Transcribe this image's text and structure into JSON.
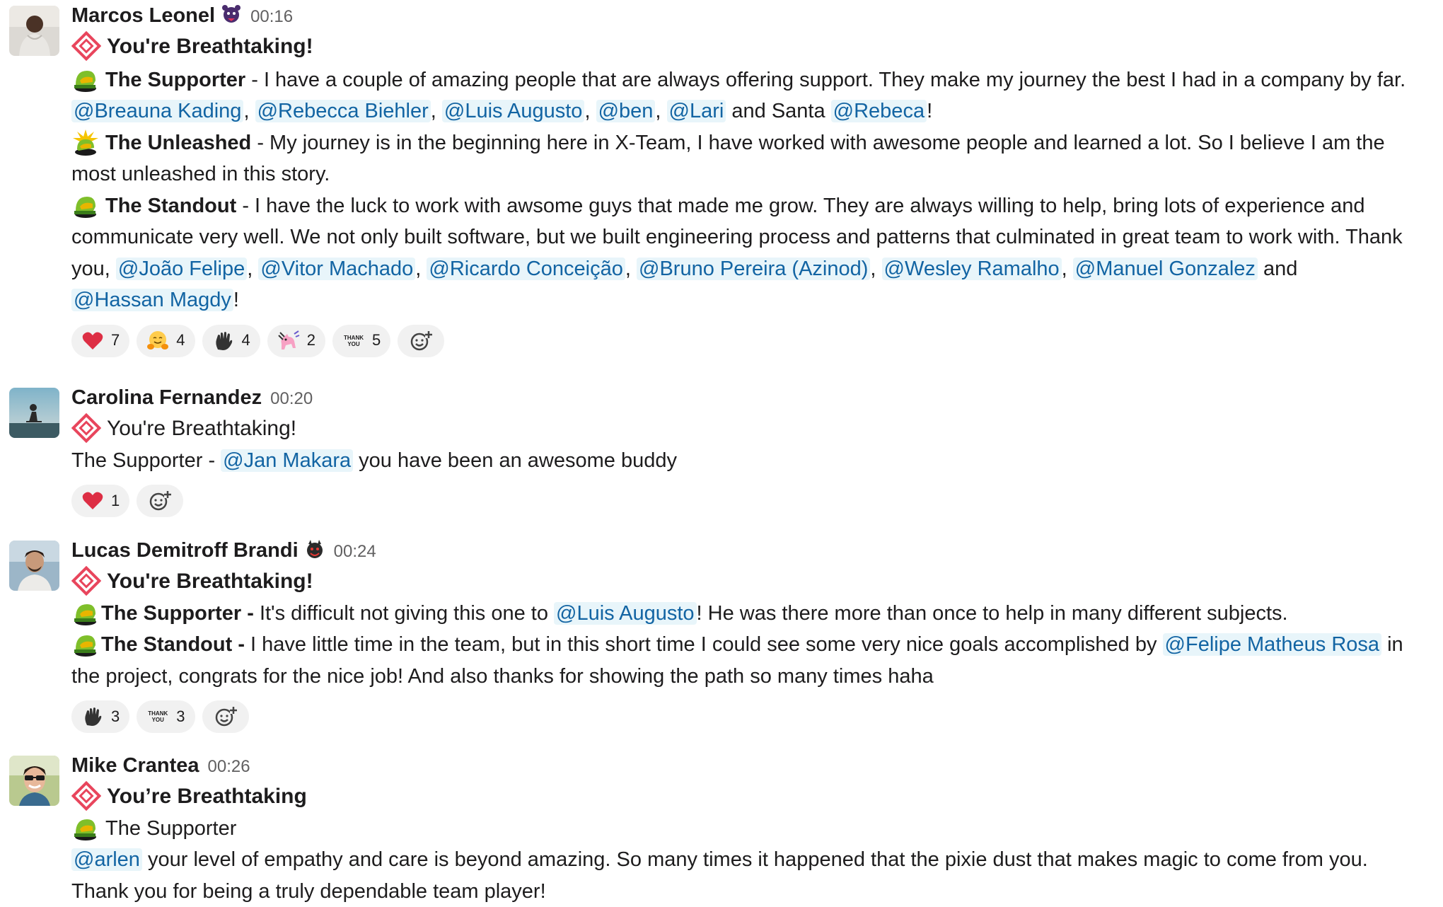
{
  "messages": [
    {
      "author": "Marcos Leonel",
      "time": "00:16",
      "title": "You're Breathtaking!",
      "supporter_label": "The Supporter",
      "supporter_text": " - I have a couple of amazing people that are always offering support. They make my journey the best I had in a company by far.",
      "supporter_mentions": [
        "@Breauna Kading",
        "@Rebecca Biehler",
        "@Luis Augusto",
        "@ben",
        "@Lari"
      ],
      "and_santa": "and Santa",
      "santa_mention": "@Rebeca",
      "unleashed_label": "The Unleashed",
      "unleashed_text": " - My journey is in the beginning here in X-Team, I have worked with awesome people and learned a lot. So I believe I am the most unleashed in this story.",
      "standout_label": "The Standout",
      "standout_text": " - I have the luck to work with awsome guys that made me grow. They are always willing to help, bring lots of experience and communicate very well. We not only built software, but we built engineering process and patterns that culminated in great team to work with.",
      "thank_you": "Thank you,",
      "standout_mentions": [
        "@João Felipe",
        "@Vitor Machado",
        "@Ricardo Conceição",
        "@Bruno Pereira (Azinod)",
        "@Wesley Ramalho",
        "@Manuel Gonzalez"
      ],
      "and_word": "and",
      "final_mention": "@Hassan Magdy",
      "reactions": [
        {
          "emoji": "heart-icon",
          "count": "7"
        },
        {
          "emoji": "hugging-face-icon",
          "count": "4"
        },
        {
          "emoji": "wave-hand-icon",
          "count": "4"
        },
        {
          "emoji": "party-pony-icon",
          "count": "2"
        },
        {
          "emoji": "thank-you-icon",
          "count": "5"
        }
      ]
    },
    {
      "author": "Carolina Fernandez",
      "time": "00:20",
      "title": "You're Breathtaking!",
      "supporter_label": "The Supporter - ",
      "mention": "@Jan Makara",
      "text": " you have been an awesome buddy",
      "reactions": [
        {
          "emoji": "heart-icon",
          "count": "1"
        }
      ]
    },
    {
      "author": "Lucas Demitroff Brandi",
      "time": "00:24",
      "title": "You're Breathtaking!",
      "supporter_label": "The Supporter -",
      "supporter_text": " It's difficult not giving this one to ",
      "supporter_mention": "@Luis Augusto",
      "supporter_tail": "! He was there more than once to help in many different subjects.",
      "standout_label": "The Standout -",
      "standout_text": " I have little time in the team, but in this short time I could see some very nice goals accomplished by ",
      "standout_mention": "@Felipe Matheus Rosa",
      "standout_tail": " in the project, congrats for the nice job! And also thanks for showing the path so many times haha",
      "reactions": [
        {
          "emoji": "wave-hand-icon",
          "count": "3"
        },
        {
          "emoji": "thank-you-icon",
          "count": "3"
        }
      ]
    },
    {
      "author": "Mike Crantea",
      "time": "00:26",
      "title": "You’re Breathtaking",
      "supporter_label": "The Supporter",
      "mention": "@arlen",
      "text": " your level of empathy and care is beyond amazing. So many times it happened that the pixie dust that makes magic to come from you. Thank you for being a truly dependable team player!"
    }
  ],
  "thank_you_emoji_text": "THANK YOU",
  "colors": {
    "mention": "#1264a3",
    "mention_bg": "#e8f5fa",
    "timestamp": "#616061",
    "pill_bg": "#f1f1f1"
  }
}
